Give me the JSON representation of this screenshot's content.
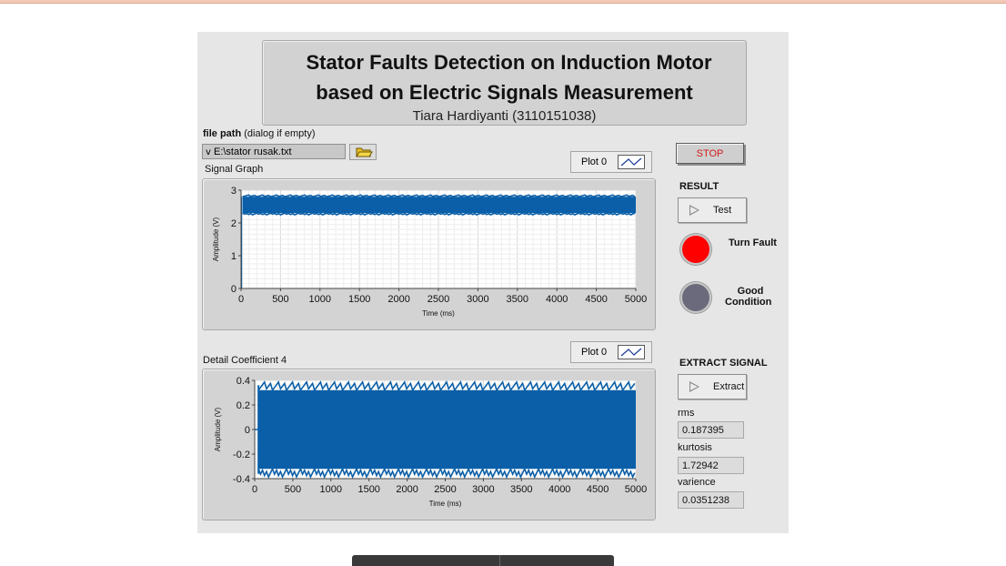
{
  "window": {
    "title_line1": "Stator Faults Detection on Induction Motor",
    "title_line2": "based on Electric Signals Measurement",
    "author": "Tiara Hardiyanti (3110151038)"
  },
  "file_path": {
    "label": "file path",
    "hint": "(dialog if empty)",
    "value": "E:\\stator rusak.txt",
    "icon": "folder-icon"
  },
  "stop_label": "STOP",
  "result": {
    "heading": "RESULT",
    "test_label": "Test",
    "turn_fault_label": "Turn Fault",
    "good_label_line1": "Good",
    "good_label_line2": "Condition",
    "turn_fault_color": "#ff0000",
    "good_color": "#6a6a7c"
  },
  "extract": {
    "heading": "EXTRACT SIGNAL",
    "button_label": "Extract",
    "rms_label": "rms",
    "rms_value": "0.187395",
    "kurtosis_label": "kurtosis",
    "kurtosis_value": "1.72942",
    "varience_label": "varience",
    "varience_value": "0.0351238"
  },
  "chart_data": [
    {
      "type": "line",
      "title": "Signal Graph",
      "legend": "Plot 0",
      "xlabel": "Time (ms)",
      "ylabel": "Amplitude (V)",
      "xlim": [
        0,
        5000
      ],
      "ylim": [
        0,
        3
      ],
      "xticks": [
        0,
        500,
        1000,
        1500,
        2000,
        2500,
        3000,
        3500,
        4000,
        4500,
        5000
      ],
      "yticks": [
        0,
        1,
        2,
        3
      ],
      "grid": true,
      "series_color": "#0a5fa8",
      "signal": {
        "start_x": 0,
        "start_y": 0,
        "band_from_x": 20,
        "band_to_x": 5000,
        "band_min": 2.3,
        "band_max": 2.8
      }
    },
    {
      "type": "line",
      "title": "Detail Coefficient 4",
      "legend": "Plot 0",
      "xlabel": "Time (ms)",
      "ylabel": "Amplitude (V)",
      "xlim": [
        0,
        5000
      ],
      "ylim": [
        -0.4,
        0.4
      ],
      "xticks": [
        0,
        500,
        1000,
        1500,
        2000,
        2500,
        3000,
        3500,
        4000,
        4500,
        5000
      ],
      "yticks": [
        -0.4,
        -0.2,
        0,
        0.2,
        0.4
      ],
      "grid": true,
      "series_color": "#0a5fa8",
      "signal": {
        "start_x": 0,
        "start_y": 0,
        "band_from_x": 50,
        "band_to_x": 5000,
        "band_min": -0.32,
        "band_max": 0.32,
        "spike_max": 0.36
      }
    }
  ]
}
